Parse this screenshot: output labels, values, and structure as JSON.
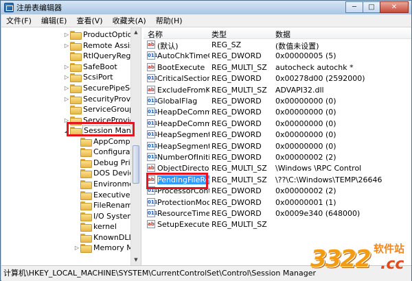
{
  "window": {
    "title": "注册表编辑器",
    "minimize": "─",
    "maximize": "□",
    "close": "✕"
  },
  "menu": [
    "文件(F)",
    "编辑(E)",
    "查看(V)",
    "收藏夹(A)",
    "帮助(H)"
  ],
  "tree": {
    "items": [
      {
        "label": "ProductOptions",
        "expander": "▷"
      },
      {
        "label": "Remote Assistar",
        "expander": "▷"
      },
      {
        "label": "RtlQueryRegistry",
        "expander": ""
      },
      {
        "label": "SafeBoot",
        "expander": "▷"
      },
      {
        "label": "ScsiPort",
        "expander": "▷"
      },
      {
        "label": "SecurePipeServe",
        "expander": "▷"
      },
      {
        "label": "SecurityProvider",
        "expander": "▷"
      },
      {
        "label": "ServiceGroupOr",
        "expander": ""
      },
      {
        "label": "ServiceProvider",
        "expander": "▷"
      },
      {
        "label": "Session Manage",
        "expander": "◢"
      },
      {
        "label": "AppCompatC",
        "expander": ""
      },
      {
        "label": "Configuration",
        "expander": ""
      },
      {
        "label": "Debug Print",
        "expander": ""
      },
      {
        "label": "DOS Devices",
        "expander": ""
      },
      {
        "label": "Environment",
        "expander": ""
      },
      {
        "label": "Executive",
        "expander": ""
      },
      {
        "label": "FileRenameO",
        "expander": ""
      },
      {
        "label": "I/O System",
        "expander": ""
      },
      {
        "label": "kernel",
        "expander": ""
      },
      {
        "label": "KnownDLLs",
        "expander": ""
      },
      {
        "label": "Memory Mar",
        "expander": "▷"
      }
    ]
  },
  "values": {
    "headers": {
      "name": "名称",
      "type": "类型",
      "data": "数据"
    },
    "rows": [
      {
        "icon": "ab",
        "name": "(默认)",
        "type": "REG_SZ",
        "data": "(数值未设置)"
      },
      {
        "icon": "bin",
        "name": "AutoChkTimeO...",
        "type": "REG_DWORD",
        "data": "0x00000005 (5)"
      },
      {
        "icon": "ab",
        "name": "BootExecute",
        "type": "REG_MULTI_SZ",
        "data": "autocheck autochk *"
      },
      {
        "icon": "bin",
        "name": "CriticalSection...",
        "type": "REG_DWORD",
        "data": "0x00278d00 (2592000)"
      },
      {
        "icon": "ab",
        "name": "ExcludeFromK...",
        "type": "REG_MULTI_SZ",
        "data": "ADVAPI32.dll"
      },
      {
        "icon": "bin",
        "name": "GlobalFlag",
        "type": "REG_DWORD",
        "data": "0x00000000 (0)"
      },
      {
        "icon": "bin",
        "name": "HeapDeComm...",
        "type": "REG_DWORD",
        "data": "0x00000000 (0)"
      },
      {
        "icon": "bin",
        "name": "HeapDeComm...",
        "type": "REG_DWORD",
        "data": "0x00000000 (0)"
      },
      {
        "icon": "bin",
        "name": "HeapSegment...",
        "type": "REG_DWORD",
        "data": "0x00000000 (0)"
      },
      {
        "icon": "bin",
        "name": "HeapSegment...",
        "type": "REG_DWORD",
        "data": "0x00000000 (0)"
      },
      {
        "icon": "bin",
        "name": "NumberOfIniti...",
        "type": "REG_DWORD",
        "data": "0x00000002 (2)"
      },
      {
        "icon": "ab",
        "name": "ObjectDirector...",
        "type": "REG_MULTI_SZ",
        "data": "\\Windows \\RPC Control"
      },
      {
        "icon": "ab",
        "name": "PendingFileRe...",
        "type": "REG_MULTI_SZ",
        "data": "\\??\\C:\\Windows\\TEMP\\26646"
      },
      {
        "icon": "bin",
        "name": "ProcessorCont...",
        "type": "REG_DWORD",
        "data": "0x00000002 (2)"
      },
      {
        "icon": "bin",
        "name": "ProtectionMode",
        "type": "REG_DWORD",
        "data": "0x00000001 (1)"
      },
      {
        "icon": "bin",
        "name": "ResourceTime...",
        "type": "REG_DWORD",
        "data": "0x0009e340 (648000)"
      },
      {
        "icon": "ab",
        "name": "SetupExecute",
        "type": "REG_MULTI_SZ",
        "data": ""
      }
    ]
  },
  "statusbar": "计算机\\HKEY_LOCAL_MACHINE\\SYSTEM\\CurrentControlSet\\Control\\Session Manager",
  "watermark": {
    "number": "3322",
    "site": "软件站",
    "tld": ".cc"
  },
  "colors": {
    "highlight_box": "#e8141b",
    "selection": "#3399ff"
  }
}
